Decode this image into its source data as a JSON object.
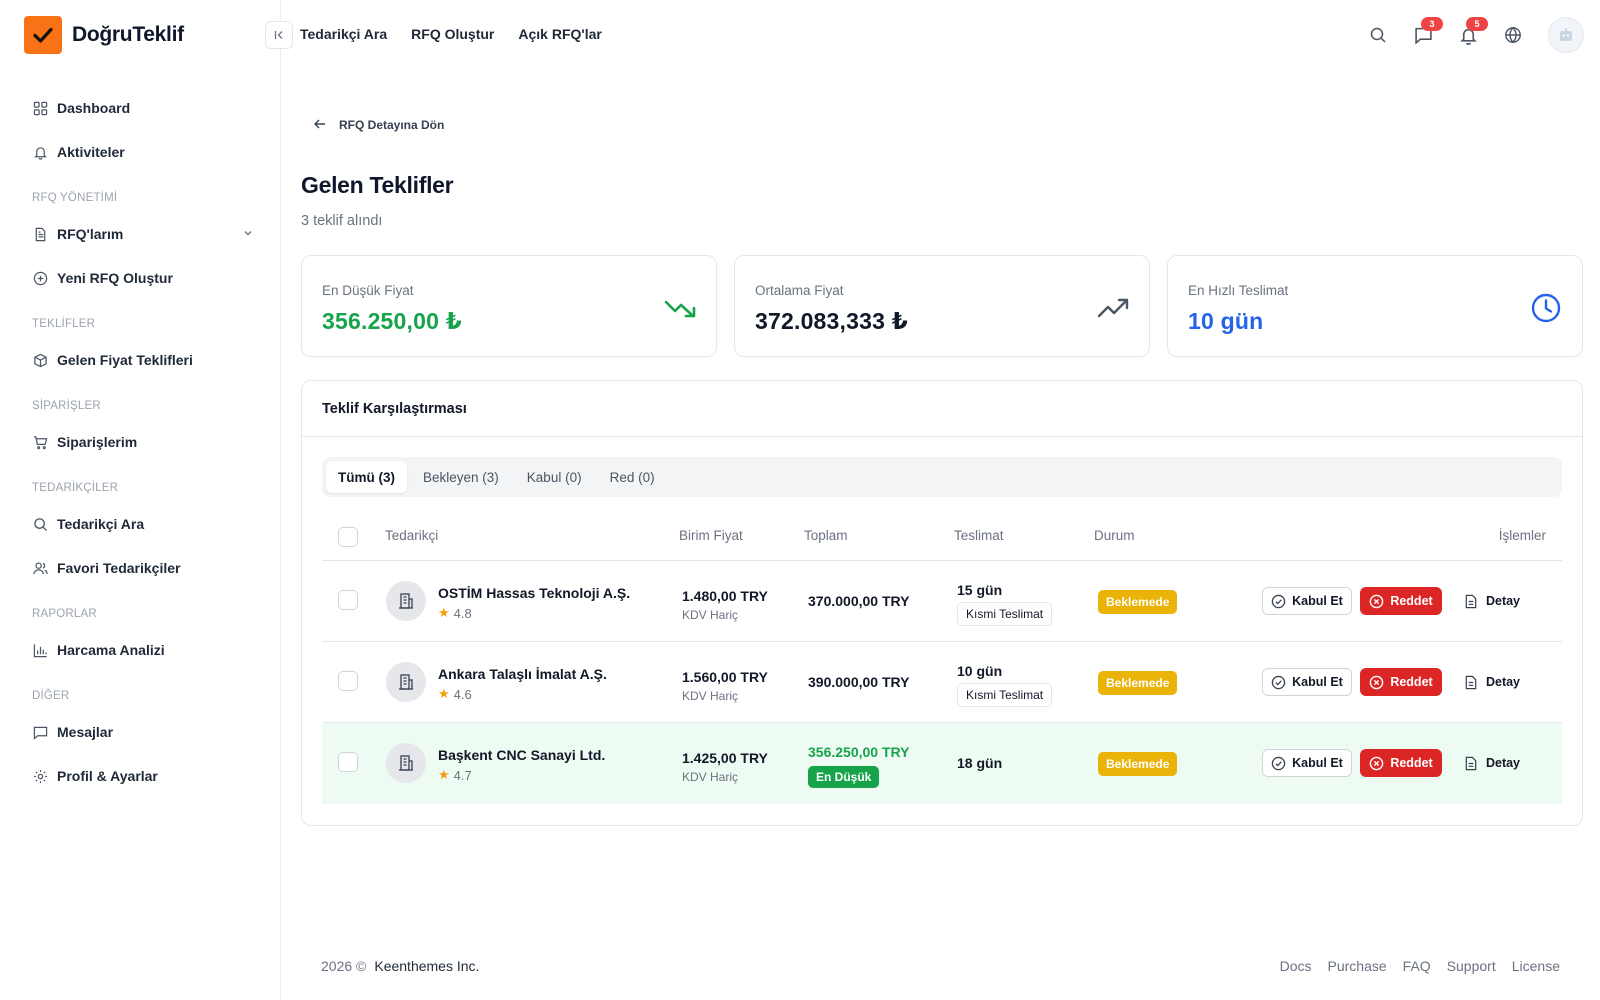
{
  "app": {
    "brand_name": "DoğruTeklif",
    "accent": "#f97316"
  },
  "sidebar": {
    "items": [
      {
        "label": "Dashboard",
        "icon": "grid-icon"
      },
      {
        "label": "Aktiviteler",
        "icon": "bell-icon"
      }
    ],
    "sections": [
      {
        "title": "RFQ YÖNETİMİ",
        "items": [
          {
            "label": "RFQ'larım",
            "icon": "document-icon"
          },
          {
            "label": "Yeni RFQ Oluştur",
            "icon": "plus-circle-icon"
          }
        ]
      },
      {
        "title": "TEKLİFLER",
        "items": [
          {
            "label": "Gelen Fiyat Teklifleri",
            "icon": "cube-icon"
          }
        ]
      },
      {
        "title": "SİPARİŞLER",
        "items": [
          {
            "label": "Siparişlerim",
            "icon": "cart-icon"
          }
        ]
      },
      {
        "title": "TEDARİKÇİLER",
        "items": [
          {
            "label": "Tedarikçi Ara",
            "icon": "search-icon"
          },
          {
            "label": "Favori Tedarikçiler",
            "icon": "users-icon"
          }
        ]
      },
      {
        "title": "RAPORLAR",
        "items": [
          {
            "label": "Harcama Analizi",
            "icon": "bar-chart-icon"
          }
        ]
      },
      {
        "title": "DİĞER",
        "items": [
          {
            "label": "Mesajlar",
            "icon": "message-icon"
          },
          {
            "label": "Profil & Ayarlar",
            "icon": "gear-icon"
          }
        ]
      }
    ]
  },
  "header": {
    "nav": [
      "Tedarikçi Ara",
      "RFQ Oluştur",
      "Açık RFQ'lar"
    ],
    "messages_count": "3",
    "notifications_count": "5"
  },
  "page": {
    "back_label": "RFQ Detayına Dön",
    "title": "Gelen Teklifler",
    "subtitle": "3 teklif alındı"
  },
  "stats": [
    {
      "label": "En Düşük Fiyat",
      "value": "356.250,00 ₺",
      "color": "#16a34a",
      "icon": "trending-down-icon"
    },
    {
      "label": "Ortalama Fiyat",
      "value": "372.083,333 ₺",
      "color": "#111827",
      "icon": "trending-up-icon"
    },
    {
      "label": "En Hızlı Teslimat",
      "value": "10 gün",
      "color": "#2563eb",
      "icon": "clock-icon"
    }
  ],
  "comparison": {
    "title": "Teklif Karşılaştırması",
    "tabs": [
      "Tümü (3)",
      "Bekleyen (3)",
      "Kabul (0)",
      "Red (0)"
    ],
    "active_tab": "Tümü (3)",
    "columns": [
      "Tedarikçi",
      "Birim Fiyat",
      "Toplam",
      "Teslimat",
      "Durum",
      "İşlemler"
    ],
    "rows": [
      {
        "supplier": "OSTİM Hassas Teknoloji A.Ş.",
        "rating": "4.8",
        "unit_price": "1.480,00 TRY",
        "unit_note": "KDV Hariç",
        "total": "370.000,00 TRY",
        "delivery": "15 gün",
        "delivery_tag": "Kısmi Teslimat",
        "status": "Beklemede",
        "accept": "Kabul Et",
        "reject": "Reddet",
        "detail": "Detay"
      },
      {
        "supplier": "Ankara Talaşlı İmalat A.Ş.",
        "rating": "4.6",
        "unit_price": "1.560,00 TRY",
        "unit_note": "KDV Hariç",
        "total": "390.000,00 TRY",
        "delivery": "10 gün",
        "delivery_tag": "Kısmi Teslimat",
        "status": "Beklemede",
        "accept": "Kabul Et",
        "reject": "Reddet",
        "detail": "Detay"
      },
      {
        "supplier": "Başkent CNC Sanayi Ltd.",
        "rating": "4.7",
        "unit_price": "1.425,00 TRY",
        "unit_note": "KDV Hariç",
        "total": "356.250,00 TRY",
        "lowest_badge": "En Düşük",
        "delivery": "18 gün",
        "status": "Beklemede",
        "accept": "Kabul Et",
        "reject": "Reddet",
        "detail": "Detay"
      }
    ]
  },
  "footer": {
    "year": "2026 ©",
    "company": "Keenthemes Inc.",
    "links": [
      "Docs",
      "Purchase",
      "FAQ",
      "Support",
      "License"
    ]
  }
}
